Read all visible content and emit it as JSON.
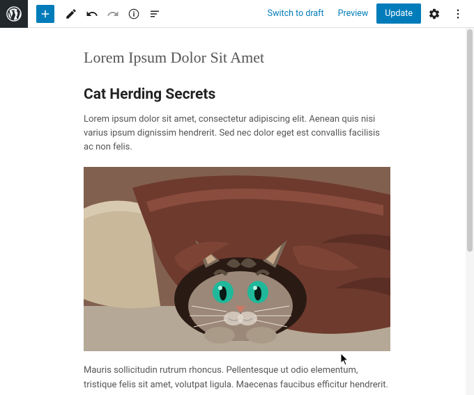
{
  "topbar": {
    "switch_to_draft": "Switch to draft",
    "preview": "Preview",
    "update": "Update"
  },
  "post": {
    "title": "Lorem Ipsum Dolor Sit Amet",
    "heading": "Cat Herding Secrets",
    "para1": "Lorem ipsum dolor sit amet, consectetur adipiscing elit. Aenean quis nisi varius ipsum dignissim hendrerit. Sed nec dolor eget est convallis facilisis ac non felis.",
    "image_alt": "cat-under-blanket",
    "para2": "Mauris sollicitudin rutrum rhoncus. Pellentesque ut odio elementum, tristique felis sit amet, volutpat ligula. Maecenas faucibus efficitur hendrerit."
  }
}
